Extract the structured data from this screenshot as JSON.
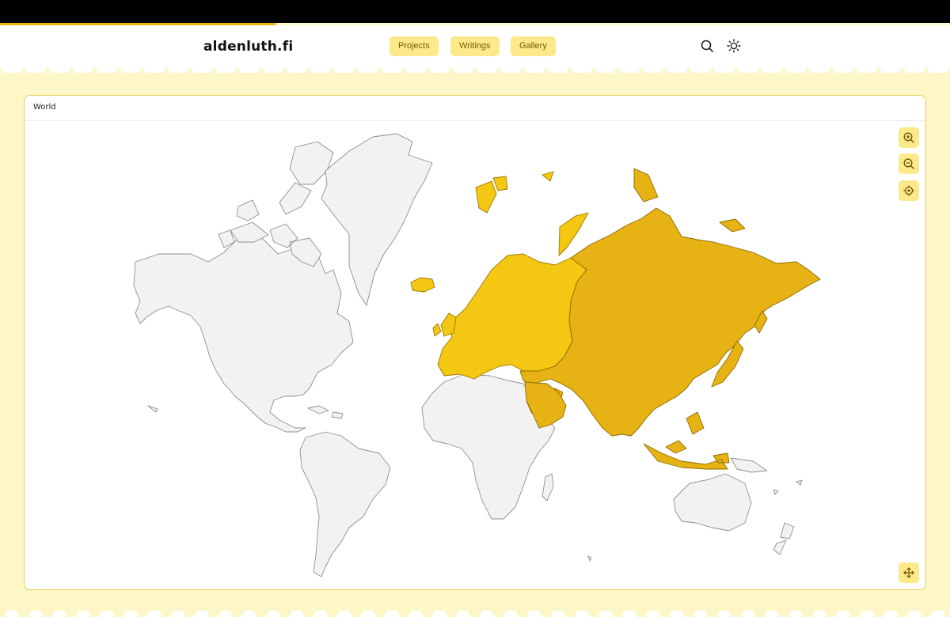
{
  "site": {
    "logo": "aldenluth.fi"
  },
  "nav": [
    {
      "label": "Projects"
    },
    {
      "label": "Writings"
    },
    {
      "label": "Gallery"
    }
  ],
  "header_icons": [
    "search-icon",
    "sun-icon"
  ],
  "map": {
    "title": "World",
    "highlighted_regions": [
      "Europe",
      "Asia"
    ],
    "controls": [
      "zoom-in-icon",
      "zoom-out-icon",
      "locate-icon",
      "move-icon"
    ]
  },
  "colors": {
    "accent": "#fbe98a",
    "background": "#fdf6c6",
    "europe_fill": "#f4c712",
    "asia_fill": "#e6b214",
    "land_fill": "#f2f2f2"
  }
}
